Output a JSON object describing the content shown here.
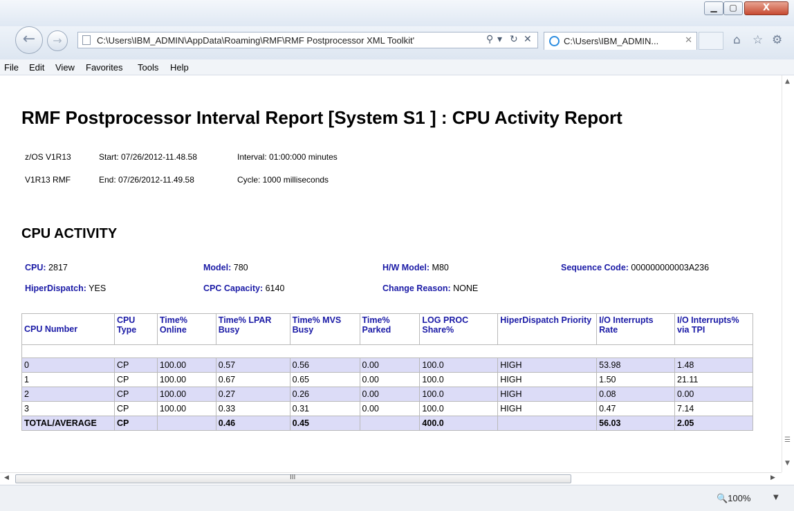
{
  "window": {
    "minimize_glyph": "▁",
    "maximize_glyph": "▢",
    "close_glyph": "X"
  },
  "browser": {
    "back_glyph": "←",
    "forward_glyph": "→",
    "address": "C:\\Users\\IBM_ADMIN\\AppData\\Roaming\\RMF\\RMF Postprocessor XML Toolkit'",
    "search_glyph": "⚲",
    "dropdown_glyph": "▾",
    "refresh_glyph": "↻",
    "stop_glyph": "✕",
    "tab_title": "C:\\Users\\IBM_ADMIN...",
    "tab_close": "✕",
    "home_glyph": "⌂",
    "favorites_glyph": "☆",
    "tools_glyph": "⚙"
  },
  "menu": [
    "File",
    "Edit",
    "View",
    "Favorites",
    "Tools",
    "Help"
  ],
  "report": {
    "title": "RMF Postprocessor Interval Report [System S1 ] : CPU Activity Report",
    "os": "z/OS V1R13",
    "start": "Start: 07/26/2012-11.48.58",
    "interval": "Interval: 01:00:000 minutes",
    "rmf": "V1R13 RMF",
    "end": "End: 07/26/2012-11.49.58",
    "cycle": "Cycle: 1000 milliseconds"
  },
  "section_title": "CPU ACTIVITY",
  "fields": {
    "cpu_label": "CPU:",
    "cpu_value": "2817",
    "model_label": "Model:",
    "model_value": "780",
    "hw_label": "H/W Model:",
    "hw_value": "M80",
    "seq_label": "Sequence Code:",
    "seq_value": "000000000003A236",
    "hd_label": "HiperDispatch:",
    "hd_value": "YES",
    "cap_label": "CPC Capacity:",
    "cap_value": "6140",
    "reason_label": "Change Reason:",
    "reason_value": "NONE"
  },
  "table": {
    "headers": [
      "CPU Number",
      "CPU Type",
      "Time% Online",
      "Time% LPAR Busy",
      "Time% MVS Busy",
      "Time% Parked",
      "LOG PROC Share%",
      "HiperDispatch Priority",
      "I/O Interrupts Rate",
      "I/O Interrupts% via TPI"
    ],
    "rows": [
      [
        "0",
        "CP",
        "100.00",
        "0.57",
        "0.56",
        "0.00",
        "100.0",
        "HIGH",
        "53.98",
        "1.48"
      ],
      [
        "1",
        "CP",
        "100.00",
        "0.67",
        "0.65",
        "0.00",
        "100.0",
        "HIGH",
        "1.50",
        "21.11"
      ],
      [
        "2",
        "CP",
        "100.00",
        "0.27",
        "0.26",
        "0.00",
        "100.0",
        "HIGH",
        "0.08",
        "0.00"
      ],
      [
        "3",
        "CP",
        "100.00",
        "0.33",
        "0.31",
        "0.00",
        "100.0",
        "HIGH",
        "0.47",
        "7.14"
      ]
    ],
    "total": [
      "TOTAL/AVERAGE",
      "CP",
      "",
      "0.46",
      "0.45",
      "",
      "400.0",
      "",
      "56.03",
      "2.05"
    ]
  },
  "scroll": {
    "up": "▲",
    "down": "▼",
    "left": "◀",
    "right": "▶",
    "grip": "III",
    "vgrip": "☰"
  },
  "status": {
    "zoom": "🔍100%",
    "zoom_dropdown": "▼"
  }
}
